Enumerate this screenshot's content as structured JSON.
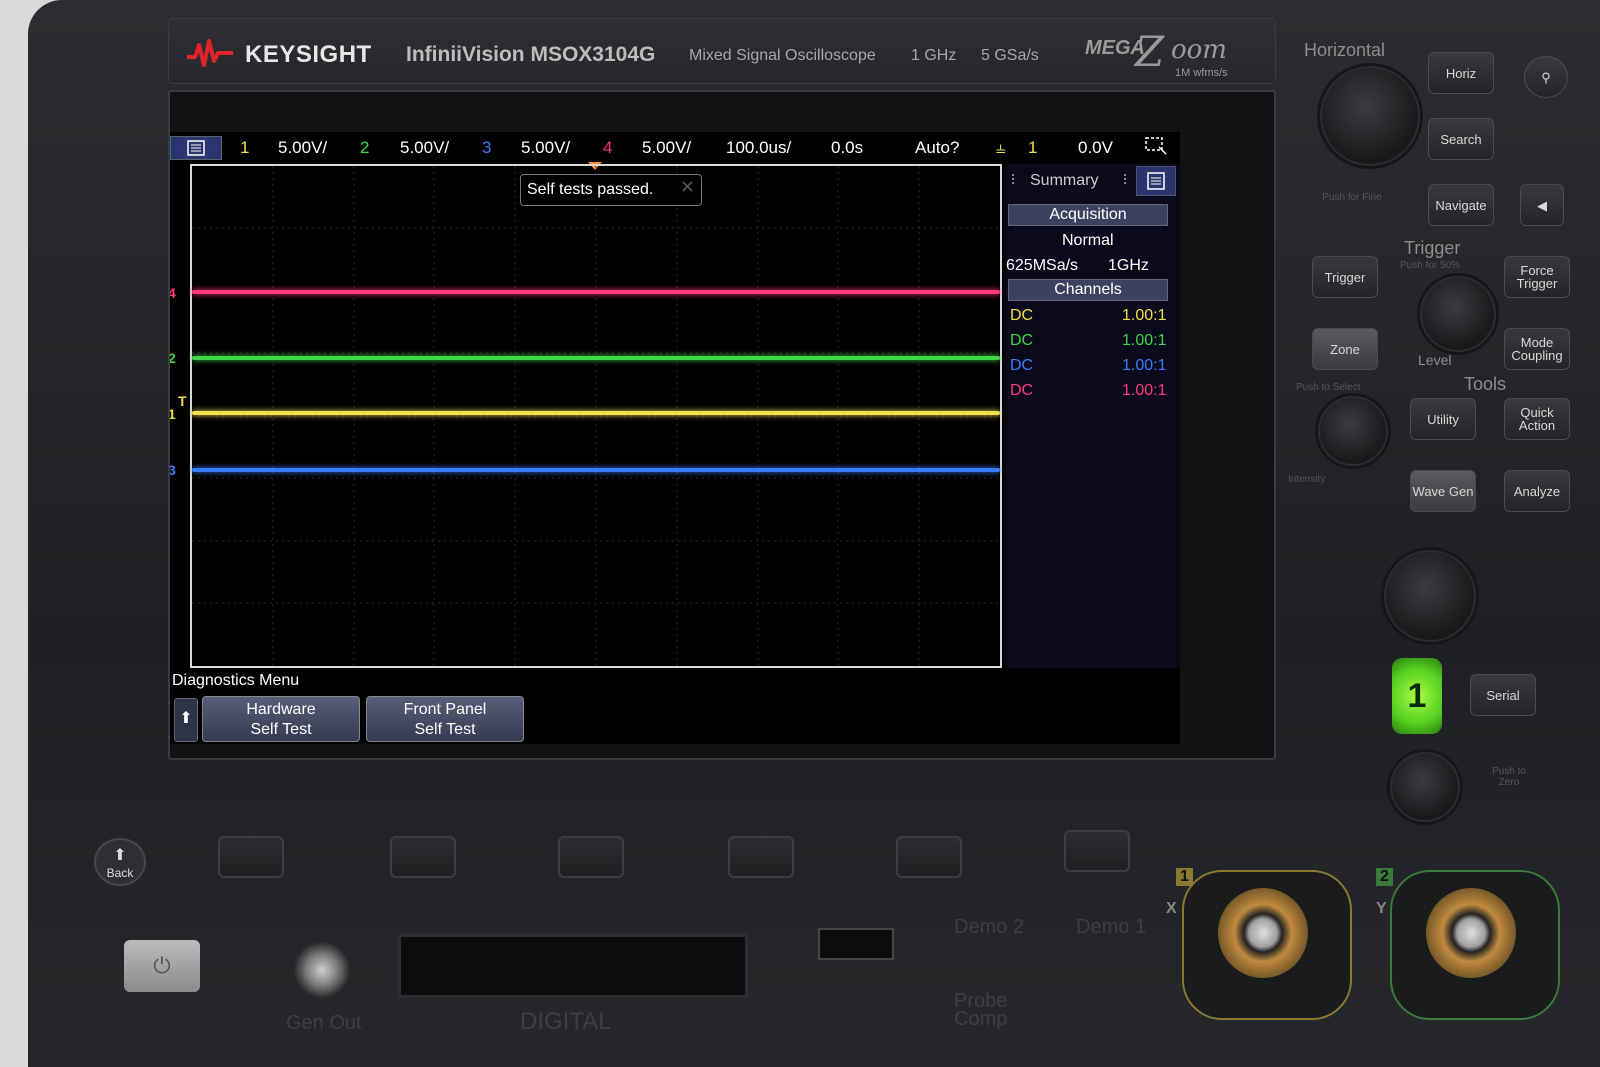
{
  "header": {
    "brand": "KEYSIGHT",
    "model": "InfiniiVision MSOX3104G",
    "description": "Mixed Signal Oscilloscope",
    "bandwidth": "1 GHz",
    "sample_rate": "5 GSa/s",
    "megazoom_mega": "MEGA",
    "megazoom_z": "Z",
    "megazoom_oom": "oom",
    "megazoom_sub": "1M wfms/s"
  },
  "colors": {
    "ch1": "#f2e04a",
    "ch2": "#3fd64a",
    "ch3": "#3a7cff",
    "ch4": "#ff3a7a",
    "accent_panel": "#2a3570"
  },
  "status_bar": {
    "ch1_label": "1",
    "ch1_scale": "5.00V/",
    "ch2_label": "2",
    "ch2_scale": "5.00V/",
    "ch3_label": "3",
    "ch3_scale": "5.00V/",
    "ch4_label": "4",
    "ch4_scale": "5.00V/",
    "timebase": "100.0us/",
    "delay": "0.0s",
    "trigger_mode": "Auto?",
    "trigger_source": "1",
    "trigger_level": "0.0V"
  },
  "popup": {
    "message": "Self tests passed."
  },
  "ground_markers": {
    "ch4": "4",
    "ch2": "2",
    "ch1": "1",
    "ch3": "3",
    "trigger": "T"
  },
  "summary": {
    "title": "Summary",
    "acquisition_header": "Acquisition",
    "acq_mode": "Normal",
    "acq_rate": "625MSa/s",
    "acq_bw": "1GHz",
    "channels_header": "Channels",
    "channels": [
      {
        "coupling": "DC",
        "probe": "1.00:1"
      },
      {
        "coupling": "DC",
        "probe": "1.00:1"
      },
      {
        "coupling": "DC",
        "probe": "1.00:1"
      },
      {
        "coupling": "DC",
        "probe": "1.00:1"
      }
    ]
  },
  "softkeys": {
    "menu_title": "Diagnostics Menu",
    "key1_line1": "Hardware",
    "key1_line2": "Self Test",
    "key2_line1": "Front Panel",
    "key2_line2": "Self Test"
  },
  "panel": {
    "horizontal_label": "Horizontal",
    "horiz_btn": "Horiz",
    "search_btn": "Search",
    "navigate_btn": "Navigate",
    "push_for_fine": "Push for Fine",
    "trigger_label": "Trigger",
    "trigger_btn": "Trigger",
    "force_trigger_btn": "Force Trigger",
    "push_for_50": "Push for 50%",
    "zone_btn": "Zone",
    "mode_coupling_btn": "Mode Coupling",
    "level_label": "Level",
    "tools_label": "Tools",
    "push_to_select": "Push to Select",
    "utility_btn": "Utility",
    "quick_action_btn": "Quick Action",
    "intensity_label": "Intensity",
    "wavegen_btn": "Wave Gen",
    "analyze_btn": "Analyze",
    "ch1_btn": "1",
    "serial_btn": "Serial",
    "push_to_zero": "Push to Zero",
    "back_btn": "Back",
    "gen_out": "Gen Out",
    "digital": "DIGITAL",
    "demo2": "Demo 2",
    "demo1": "Demo 1",
    "probe_comp": "Probe Comp",
    "bnc_ch1_tag": "1",
    "bnc_ch2_tag": "2",
    "bnc_x": "X",
    "bnc_y": "Y"
  }
}
